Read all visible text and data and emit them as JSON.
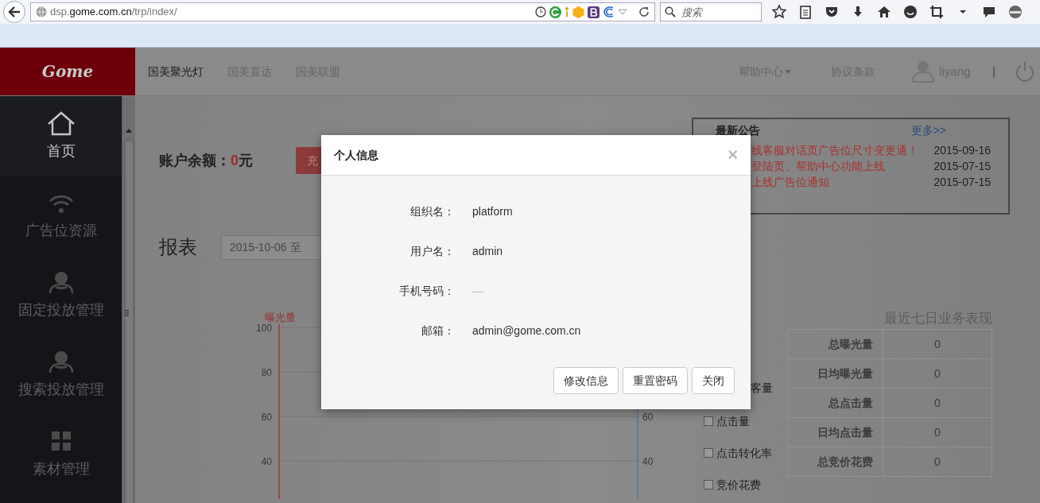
{
  "browser": {
    "url": [
      {
        "text": "dsp.",
        "kind": "dim"
      },
      {
        "text": "gome.com.cn",
        "kind": "host"
      },
      {
        "text": "/trp/index/",
        "kind": "dim"
      }
    ],
    "search_placeholder": "搜索"
  },
  "header": {
    "logo": "Gome",
    "nav": [
      {
        "label": "国美聚光灯",
        "selected": true
      },
      {
        "label": "国美直达",
        "selected": false
      },
      {
        "label": "国美联盟",
        "selected": false
      }
    ],
    "help_menu": "帮助中心",
    "terms": "协议条款",
    "username": "liyang",
    "separator": "|"
  },
  "sidebar": {
    "items": [
      {
        "label": "首页",
        "kind": "home",
        "selected": true
      },
      {
        "label": "广告位资源",
        "kind": "signal",
        "selected": false
      },
      {
        "label": "固定投放管理",
        "kind": "person",
        "selected": false
      },
      {
        "label": "搜索投放管理",
        "kind": "person",
        "selected": false
      },
      {
        "label": "素材管理",
        "kind": "grid",
        "selected": false
      }
    ]
  },
  "account": {
    "label": "账户余额：",
    "amount": "0",
    "unit": "元",
    "recharge_button": "充"
  },
  "notices": {
    "title": "最新公告",
    "more": "更多>>",
    "items": [
      {
        "title": "线客服对话页广告位尺寸变更通！",
        "date": "2015-09-16"
      },
      {
        "title": "登陆页、帮助中心功能上线",
        "date": "2015-07-15"
      },
      {
        "title": "上线广告位通知",
        "date": "2015-07-15"
      }
    ]
  },
  "report": {
    "title": "报表",
    "date_range": "2015-10-06 至"
  },
  "chart": {
    "axis_label": "曝光量",
    "left_ticks": [
      "100",
      "80",
      "60",
      "40"
    ],
    "right_ticks": [
      "60",
      "40"
    ]
  },
  "metrics": [
    {
      "label": "客量"
    },
    {
      "label": "点击量",
      "checked": false
    },
    {
      "label": "点击转化率",
      "checked": false
    },
    {
      "label": "竞价花费",
      "checked": false
    }
  ],
  "summary": {
    "title": "最近七日业务表现",
    "rows": [
      {
        "label": "总曝光量",
        "value": "0"
      },
      {
        "label": "日均曝光量",
        "value": "0"
      },
      {
        "label": "总点击量",
        "value": "0"
      },
      {
        "label": "日均点击量",
        "value": "0"
      },
      {
        "label": "总竞价花费",
        "value": "0"
      }
    ]
  },
  "modal": {
    "title": "个人信息",
    "close": "×",
    "fields": [
      {
        "label": "组织名：",
        "value": "platform",
        "empty": false
      },
      {
        "label": "用户名：",
        "value": "admin",
        "empty": false
      },
      {
        "label": "手机号码：",
        "value": "—",
        "empty": true
      },
      {
        "label": "邮箱：",
        "value": "admin@gome.com.cn",
        "empty": false
      }
    ],
    "buttons": [
      "修改信息",
      "重置密码",
      "关闭"
    ]
  }
}
